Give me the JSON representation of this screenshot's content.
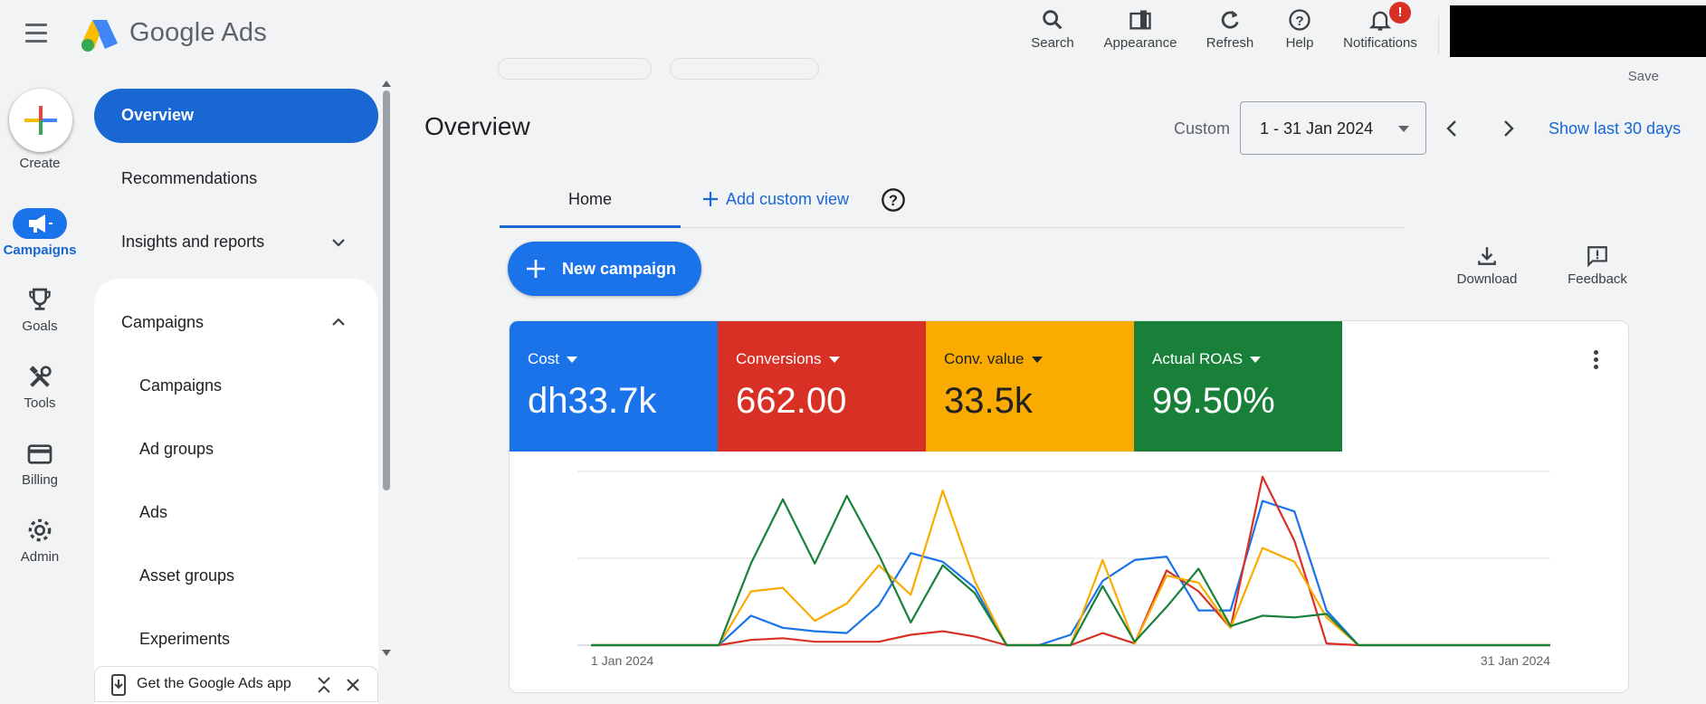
{
  "header": {
    "brand_google": "Google",
    "brand_ads": "Ads",
    "tools": [
      {
        "label": "Search",
        "icon": "search-icon"
      },
      {
        "label": "Appearance",
        "icon": "appearance-icon"
      },
      {
        "label": "Refresh",
        "icon": "refresh-icon"
      },
      {
        "label": "Help",
        "icon": "help-icon"
      },
      {
        "label": "Notifications",
        "icon": "bell-icon",
        "badge": "!"
      }
    ]
  },
  "rail": {
    "create": "Create",
    "items": [
      {
        "label": "Campaigns",
        "icon": "megaphone-icon",
        "active": true
      },
      {
        "label": "Goals",
        "icon": "trophy-icon"
      },
      {
        "label": "Tools",
        "icon": "tools-icon"
      },
      {
        "label": "Billing",
        "icon": "credit-card-icon"
      },
      {
        "label": "Admin",
        "icon": "gear-icon"
      }
    ]
  },
  "sidenav": {
    "overview": "Overview",
    "recommendations": "Recommendations",
    "insights": "Insights and reports",
    "campaigns_group": "Campaigns",
    "sub_items": [
      "Campaigns",
      "Ad groups",
      "Ads",
      "Asset groups",
      "Experiments"
    ],
    "app_banner": "Get the Google Ads app"
  },
  "main": {
    "save": "Save",
    "title": "Overview",
    "date_label": "Custom",
    "date_value": "1 - 31 Jan 2024",
    "show_last": "Show last 30 days",
    "tab_home": "Home",
    "tab_add": "Add custom view",
    "new_campaign": "New campaign",
    "download": "Download",
    "feedback": "Feedback"
  },
  "metrics": [
    {
      "label": "Cost",
      "value": "dh33.7k",
      "bg": "#1a73e8",
      "fg": "#ffffff"
    },
    {
      "label": "Conversions",
      "value": "662.00",
      "bg": "#d93025",
      "fg": "#ffffff"
    },
    {
      "label": "Conv. value",
      "value": "33.5k",
      "bg": "#f9ab00",
      "fg": "#202124"
    },
    {
      "label": "Actual ROAS",
      "value": "99.50%",
      "bg": "#188038",
      "fg": "#ffffff"
    }
  ],
  "chart_data": {
    "type": "line",
    "x_start": "1 Jan 2024",
    "x_end": "31 Jan 2024",
    "x": [
      1,
      2,
      3,
      4,
      5,
      6,
      7,
      8,
      9,
      10,
      11,
      12,
      13,
      14,
      15,
      16,
      17,
      18,
      19,
      20,
      21,
      22,
      23,
      24,
      25,
      26,
      27,
      28,
      29,
      30,
      31
    ],
    "ylim": [
      0,
      100
    ],
    "grid": true,
    "series": [
      {
        "color": "#1a73e8",
        "values": [
          0,
          0,
          0,
          0,
          0,
          17,
          10,
          8,
          7,
          23,
          53,
          48,
          33,
          0,
          0,
          6,
          37,
          49,
          51,
          20,
          20,
          83,
          77,
          20,
          0,
          0,
          0,
          0,
          0,
          0,
          0
        ]
      },
      {
        "color": "#d93025",
        "values": [
          0,
          0,
          0,
          0,
          0,
          3,
          4,
          2,
          2,
          2,
          6,
          8,
          5,
          0,
          0,
          0,
          7,
          1,
          43,
          31,
          10,
          97,
          60,
          1,
          0,
          0,
          0,
          0,
          0,
          0,
          0
        ]
      },
      {
        "color": "#f9ab00",
        "values": [
          0,
          0,
          0,
          0,
          0,
          31,
          33,
          14,
          24,
          46,
          29,
          89,
          37,
          0,
          0,
          0,
          49,
          1,
          40,
          36,
          10,
          56,
          48,
          16,
          0,
          0,
          0,
          0,
          0,
          0,
          0
        ]
      },
      {
        "color": "#188038",
        "values": [
          0,
          0,
          0,
          0,
          0,
          47,
          84,
          47,
          86,
          52,
          13,
          46,
          30,
          0,
          0,
          0,
          34,
          2,
          22,
          44,
          11,
          17,
          16,
          18,
          0,
          0,
          0,
          0,
          0,
          0,
          0
        ]
      }
    ]
  }
}
